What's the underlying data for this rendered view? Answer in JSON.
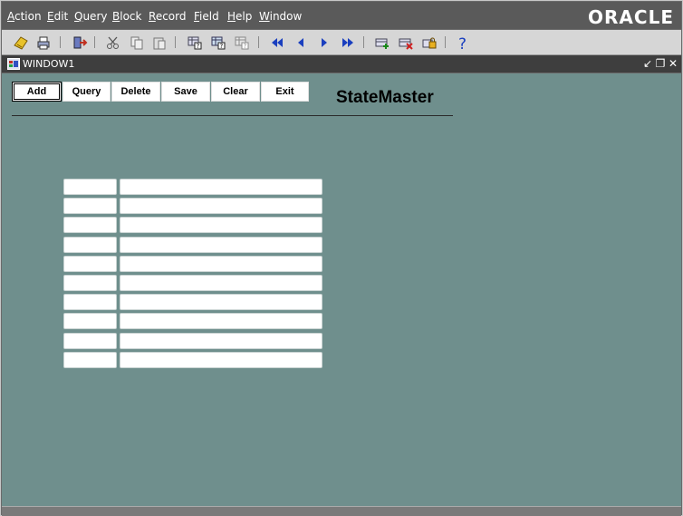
{
  "menu": {
    "items": [
      "Action",
      "Edit",
      "Query",
      "Block",
      "Record",
      "Field",
      "Help",
      "Window"
    ],
    "brand": "ORACLE"
  },
  "toolbar": {
    "icons": [
      "save-icon",
      "print-icon",
      "exit-icon",
      "cut-icon",
      "copy-icon",
      "paste-icon",
      "enter-query-icon",
      "execute-query-icon",
      "cancel-query-icon",
      "first-record-icon",
      "previous-record-icon",
      "next-record-icon",
      "last-record-icon",
      "insert-record-icon",
      "delete-record-icon",
      "lock-record-icon",
      "help-icon"
    ]
  },
  "window": {
    "title": "WINDOW1",
    "controls": {
      "minimize": "↙",
      "restore": "❐",
      "close": "✕"
    }
  },
  "form": {
    "buttons": [
      {
        "label": "Add",
        "default": true
      },
      {
        "label": "Query"
      },
      {
        "label": "Delete"
      },
      {
        "label": "Save"
      },
      {
        "label": "Clear"
      },
      {
        "label": "Exit"
      }
    ],
    "title": "StateMaster",
    "rows": [
      {
        "code": "",
        "name": ""
      },
      {
        "code": "",
        "name": ""
      },
      {
        "code": "",
        "name": ""
      },
      {
        "code": "",
        "name": ""
      },
      {
        "code": "",
        "name": ""
      },
      {
        "code": "",
        "name": ""
      },
      {
        "code": "",
        "name": ""
      },
      {
        "code": "",
        "name": ""
      },
      {
        "code": "",
        "name": ""
      },
      {
        "code": "",
        "name": ""
      }
    ]
  },
  "colors": {
    "canvas": "#6f8f8d",
    "menubar": "#5a5a5a",
    "toolbar": "#d6d6d6",
    "titlebar": "#3e3e3e",
    "accent_blue": "#1a3fbf"
  }
}
